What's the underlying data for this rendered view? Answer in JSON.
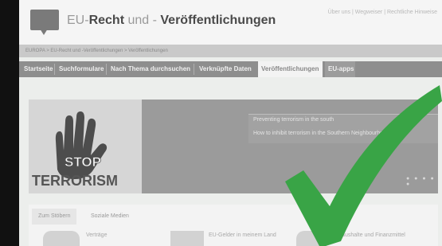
{
  "header": {
    "title_prefix": "EU-",
    "title_bold1": "Recht",
    "title_mid": " und ",
    "title_dash": "- ",
    "title_bold2": "Veröffentlichungen",
    "toplinks": "Über uns | Wegweiser | Rechtliche Hinweise"
  },
  "breadcrumb": "EUROPA > EU-Recht und -Veröffentlichungen > Veröffentlichungen",
  "nav": {
    "items": [
      "Startseite",
      "Suchformulare",
      "Nach Thema durchsuchen",
      "Verknüpfte Daten",
      "Veröffentlichungen",
      "EU-apps"
    ]
  },
  "banner": {
    "caption_line1": "Preventing terrorism in the south",
    "caption_line2": "How to inhibit terrorism in the Southern Neighbourhood",
    "image_text_top": "STOP",
    "image_text_bottom": "TERRORISM"
  },
  "tabs": [
    "Zum Stöbern",
    "Soziale Medien"
  ],
  "cards": [
    "Verträge",
    "EU-Gelder in meinem Land",
    "Haushalte und Finanzmittel"
  ],
  "colors": {
    "check": "#3aa54a"
  }
}
